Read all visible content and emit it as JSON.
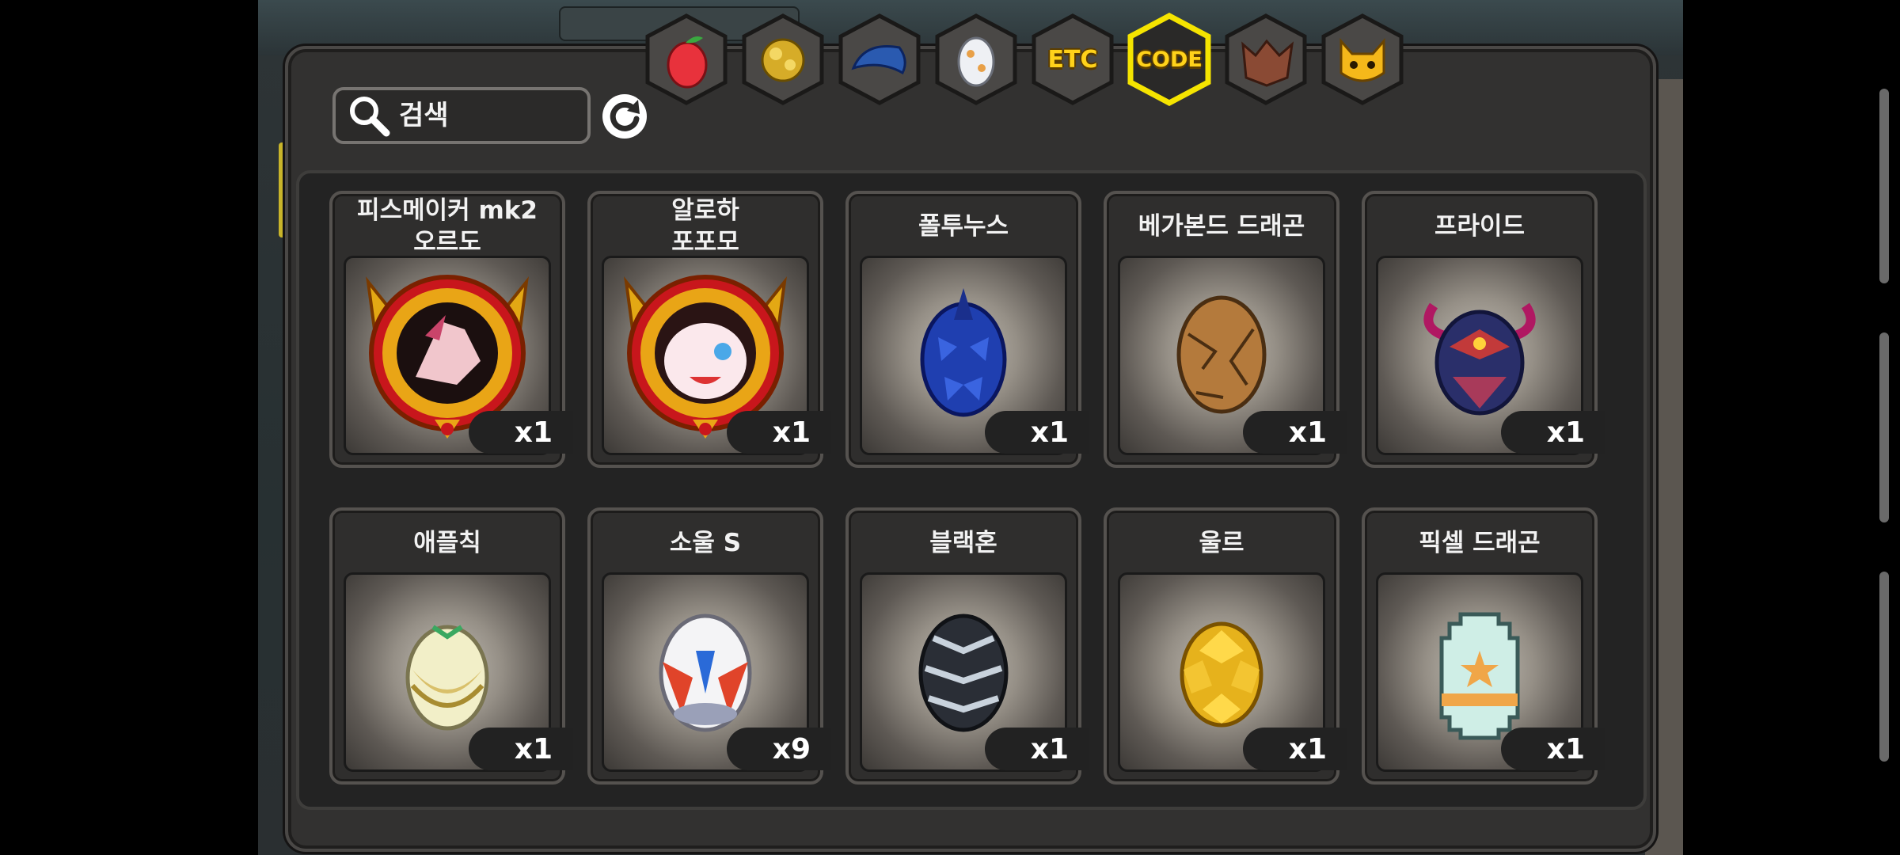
{
  "search": {
    "placeholder": "검색",
    "value": ""
  },
  "tabs": [
    {
      "id": "fruit",
      "icon": "red-fruit-icon"
    },
    {
      "id": "gold-ore",
      "icon": "gold-ore-icon"
    },
    {
      "id": "blue-scale",
      "icon": "blue-scale-icon"
    },
    {
      "id": "egg",
      "icon": "egg-icon"
    },
    {
      "id": "etc",
      "label": "ETC",
      "icon": "etc-text-icon"
    },
    {
      "id": "code",
      "label": "CODE",
      "icon": "code-text-icon",
      "selected": true
    },
    {
      "id": "beast",
      "icon": "werewolf-icon"
    },
    {
      "id": "cat",
      "icon": "yellow-cat-icon"
    }
  ],
  "items": [
    {
      "name": "피스메이커 mk2\n오르도",
      "count": "x1",
      "icon": "dragon-medal-icon"
    },
    {
      "name": "알로하\n포포모",
      "count": "x1",
      "icon": "dragon-medal-icon"
    },
    {
      "name": "폴투누스",
      "count": "x1",
      "icon": "blue-spiked-egg-icon"
    },
    {
      "name": "베가본드 드래곤",
      "count": "x1",
      "icon": "brown-cracked-egg-icon"
    },
    {
      "name": "프라이드",
      "count": "x1",
      "icon": "horned-dark-egg-icon"
    },
    {
      "name": "애플칙",
      "count": "x1",
      "icon": "winged-cream-egg-icon"
    },
    {
      "name": "소울 S",
      "count": "x9",
      "icon": "red-winged-egg-icon"
    },
    {
      "name": "블랙혼",
      "count": "x1",
      "icon": "black-spiked-egg-icon"
    },
    {
      "name": "울르",
      "count": "x1",
      "icon": "gold-armored-egg-icon"
    },
    {
      "name": "픽셀 드래곤",
      "count": "x1",
      "icon": "pixel-egg-icon"
    }
  ],
  "colors": {
    "selected_tab_outline": "#f5e400",
    "close_button": "#d8141b",
    "panel": "#323130"
  }
}
